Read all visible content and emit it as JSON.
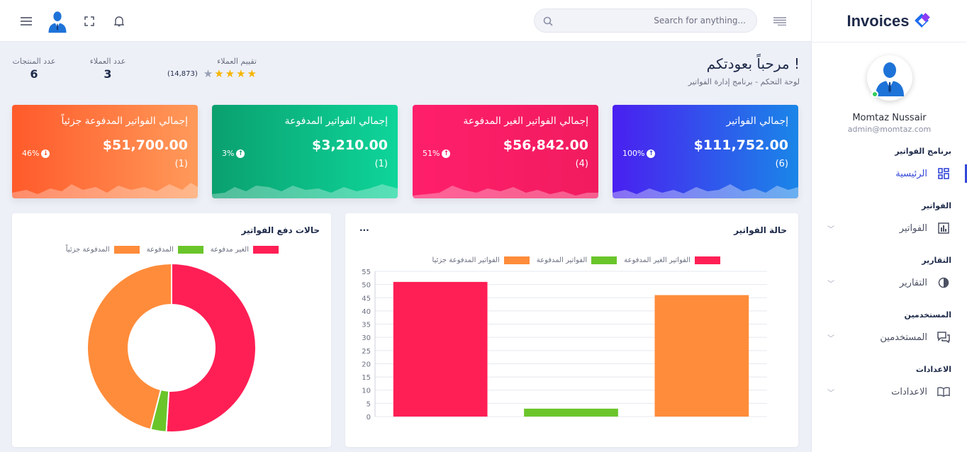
{
  "brand": {
    "name": "Invoices"
  },
  "header": {
    "search_placeholder": "Search for anything..."
  },
  "user": {
    "name": "Momtaz Nussair",
    "email": "admin@momtaz.com"
  },
  "nav": [
    {
      "section": "برنامج الفواتير",
      "label": "الرئيسية",
      "icon": "grid-icon",
      "active": true
    },
    {
      "section": "الفواتير",
      "label": "الفواتير",
      "icon": "bar-chart-icon"
    },
    {
      "section": "التقارير",
      "label": "التقارير",
      "icon": "pie-chart-icon"
    },
    {
      "section": "المستخدمين",
      "label": "المستخدمين",
      "icon": "chat-icon"
    },
    {
      "section": "الاعدادات",
      "label": "الاعدادات",
      "icon": "book-icon"
    }
  ],
  "welcome": {
    "title": "مرحباً بعودتكم !",
    "subtitle": "لوحة التحكم - برنامج إدارة الفواتير"
  },
  "stats": {
    "rating": {
      "label": "تقييم العملاء",
      "count": "(14,873)",
      "stars": 4,
      "max_stars": 5
    },
    "customers": {
      "label": "عدد العملاء",
      "value": "3"
    },
    "products": {
      "label": "عدد المنتجات",
      "value": "6"
    }
  },
  "cards": [
    {
      "title": "إجمالي الفواتير",
      "amount": "$111,752.00",
      "count": "(6)",
      "percent": "100%",
      "trend": "up",
      "colors": [
        "#4a1ff0",
        "#1a86e8"
      ]
    },
    {
      "title": "إجمالي الفواتير الغير المدفوعة",
      "amount": "$56,842.00",
      "count": "(4)",
      "percent": "51%",
      "trend": "up",
      "colors": [
        "#ff1f6b",
        "#f11b5f"
      ]
    },
    {
      "title": "إجمالي الفواتير المدفوعة",
      "amount": "$3,210.00",
      "count": "(1)",
      "percent": "3%",
      "trend": "up",
      "colors": [
        "#0aa06e",
        "#0ed59a"
      ]
    },
    {
      "title": "إجمالي الفواتير المدفوعة جزئياً",
      "amount": "$51,700.00",
      "count": "(1)",
      "percent": "46%",
      "trend": "down",
      "colors": [
        "#ff5a2a",
        "#ff9a5a"
      ]
    }
  ],
  "bar_panel": {
    "title": "حالة الفواتير",
    "menu": "..."
  },
  "donut_panel": {
    "title": "حالات دفع الفواتير"
  },
  "chart_data": [
    {
      "type": "bar",
      "categories": [
        "الفواتير الغير المدفوعة",
        "الفواتير المدفوعة",
        "الفواتير المدفوعة جزئيا"
      ],
      "values": [
        51,
        3,
        46
      ],
      "colors": [
        "#ff1f55",
        "#6ac52a",
        "#ff8c3a"
      ],
      "ylim": [
        0,
        55
      ],
      "yticks": [
        0,
        5,
        10,
        15,
        20,
        25,
        30,
        35,
        40,
        45,
        50,
        55
      ],
      "legend": [
        "الفواتير الغير المدفوعة",
        "الفواتير المدفوعة",
        "الفواتير المدفوعة جزئيا"
      ],
      "grid": true,
      "legend_position": "top"
    },
    {
      "type": "pie",
      "labels": [
        "الغير مدفوعة",
        "المدفوعة",
        "المدفوعة جزئياً"
      ],
      "values": [
        51,
        3,
        46
      ],
      "colors": [
        "#ff1f55",
        "#6ac52a",
        "#ff8c3a"
      ],
      "legend_position": "top"
    }
  ]
}
